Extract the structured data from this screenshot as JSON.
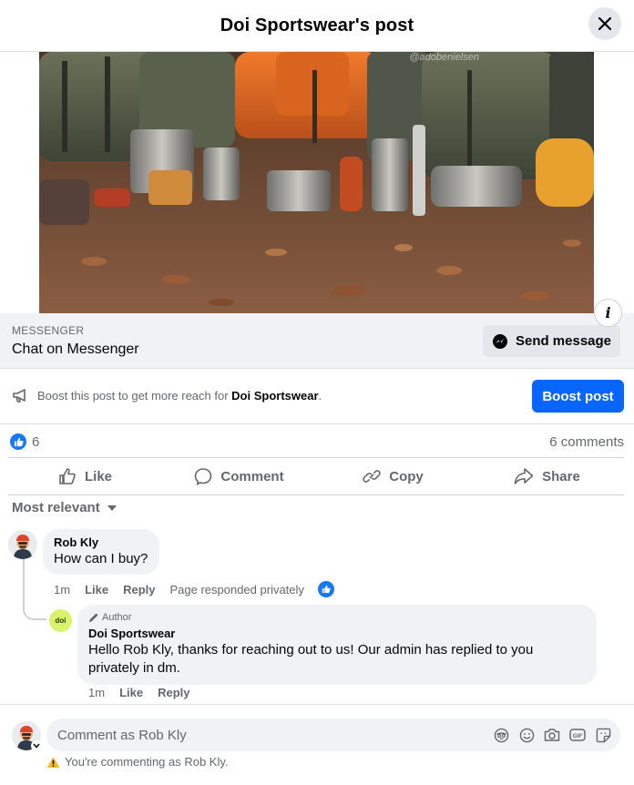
{
  "header": {
    "title": "Doi Sportswear's post"
  },
  "photo": {
    "watermark": "@adobenielsen",
    "alt": "camping gear"
  },
  "messenger": {
    "label": "MESSENGER",
    "title": "Chat on Messenger",
    "send_label": "Send message"
  },
  "boost": {
    "text_prefix": "Boost this post to get more reach for ",
    "page_name": "Doi Sportswear",
    "text_suffix": ".",
    "button_label": "Boost post"
  },
  "stats": {
    "likes": "6",
    "comments": "6 comments"
  },
  "actions": [
    {
      "label": "Like",
      "icon": "thumbs-up-icon"
    },
    {
      "label": "Comment",
      "icon": "comment-bubble-icon"
    },
    {
      "label": "Copy",
      "icon": "link-icon"
    },
    {
      "label": "Share",
      "icon": "share-arrow-icon"
    }
  ],
  "sort": {
    "label": "Most relevant"
  },
  "comments": [
    {
      "author": "Rob Kly",
      "text": "How can I buy?",
      "time": "1m",
      "like": "Like",
      "reply": "Reply",
      "note": "Page responded privately"
    },
    {
      "badge": "Author",
      "author": "Doi Sportswear",
      "avatar_text": "doi",
      "text": "Hello Rob Kly, thanks for reaching out to us! Our admin has replied to you privately in dm.",
      "time": "1m",
      "like": "Like",
      "reply": "Reply"
    }
  ],
  "composer": {
    "placeholder": "Comment as Rob Kly",
    "warning": "You're commenting as Rob Kly."
  },
  "colors": {
    "primary": "#0866ff",
    "like_blue": "#1877f2",
    "secondary_text": "#65676b",
    "surface": "#f0f2f5",
    "doi_green": "#d7f26b"
  }
}
